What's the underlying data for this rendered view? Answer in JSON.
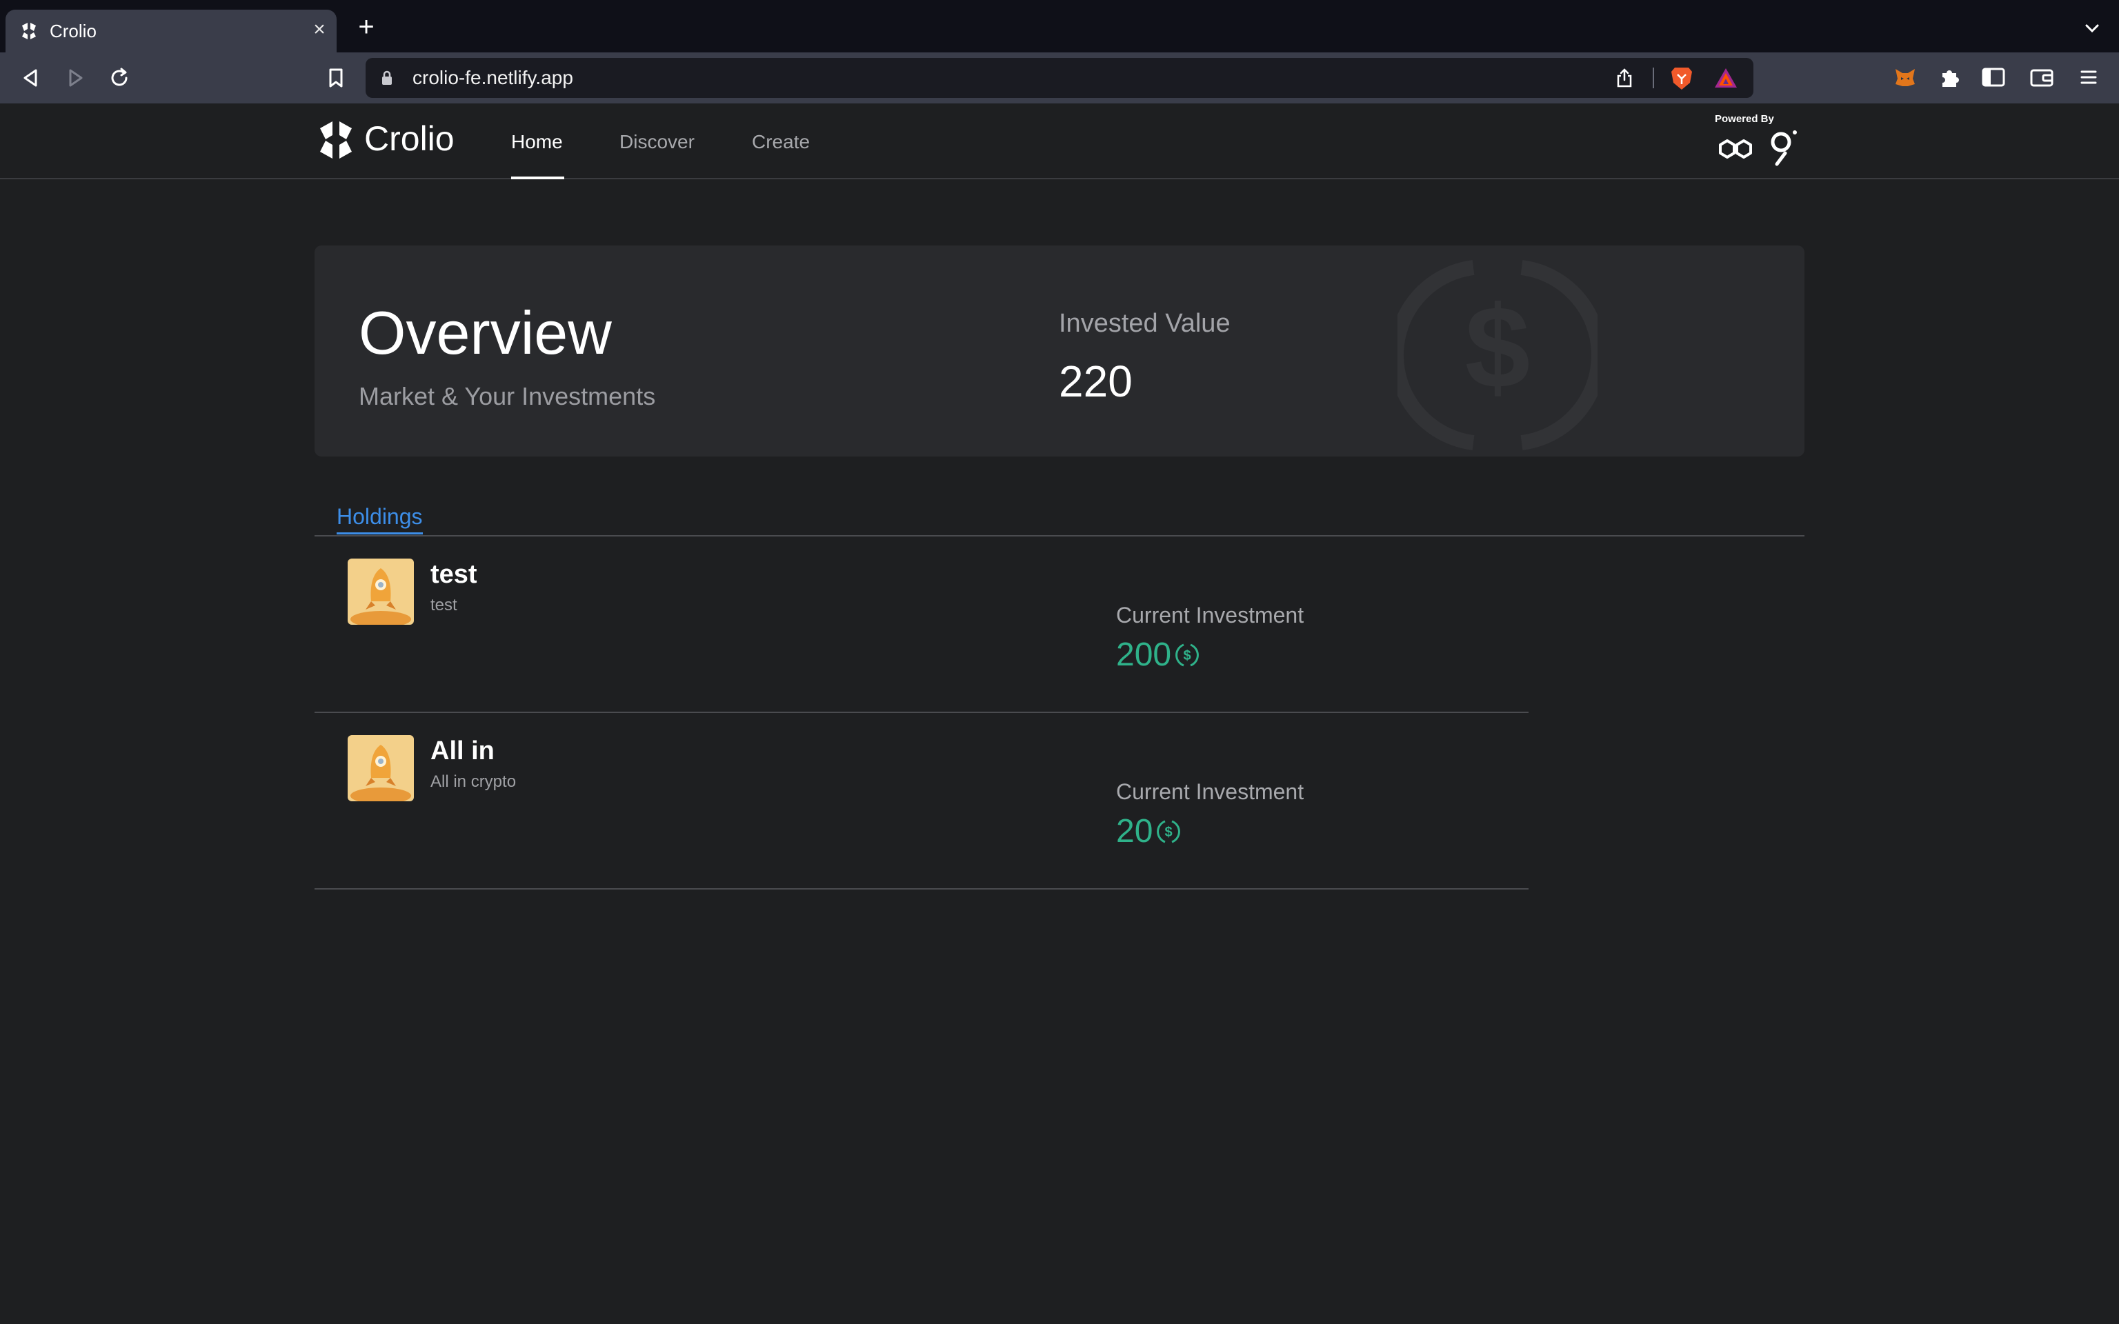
{
  "browser": {
    "tab_title": "Crolio",
    "tab_close": "×",
    "new_tab": "+",
    "url": "crolio-fe.netlify.app"
  },
  "app": {
    "logo_text": "Crolio",
    "nav": [
      {
        "label": "Home",
        "active": true
      },
      {
        "label": "Discover",
        "active": false
      },
      {
        "label": "Create",
        "active": false
      }
    ],
    "powered_by": "Powered By"
  },
  "overview": {
    "title": "Overview",
    "subtitle": "Market & Your Investments",
    "invested_label": "Invested Value",
    "invested_value": "220"
  },
  "tabs": {
    "holdings": "Holdings"
  },
  "holdings": [
    {
      "name": "test",
      "description": "test",
      "label": "Current Investment",
      "value": "200"
    },
    {
      "name": "All in",
      "description": "All in crypto",
      "label": "Current Investment",
      "value": "20"
    }
  ],
  "colors": {
    "accent_blue": "#3d8ee8",
    "value_green": "#2fb28a",
    "background": "#1e1f21",
    "card": "#292a2d"
  }
}
